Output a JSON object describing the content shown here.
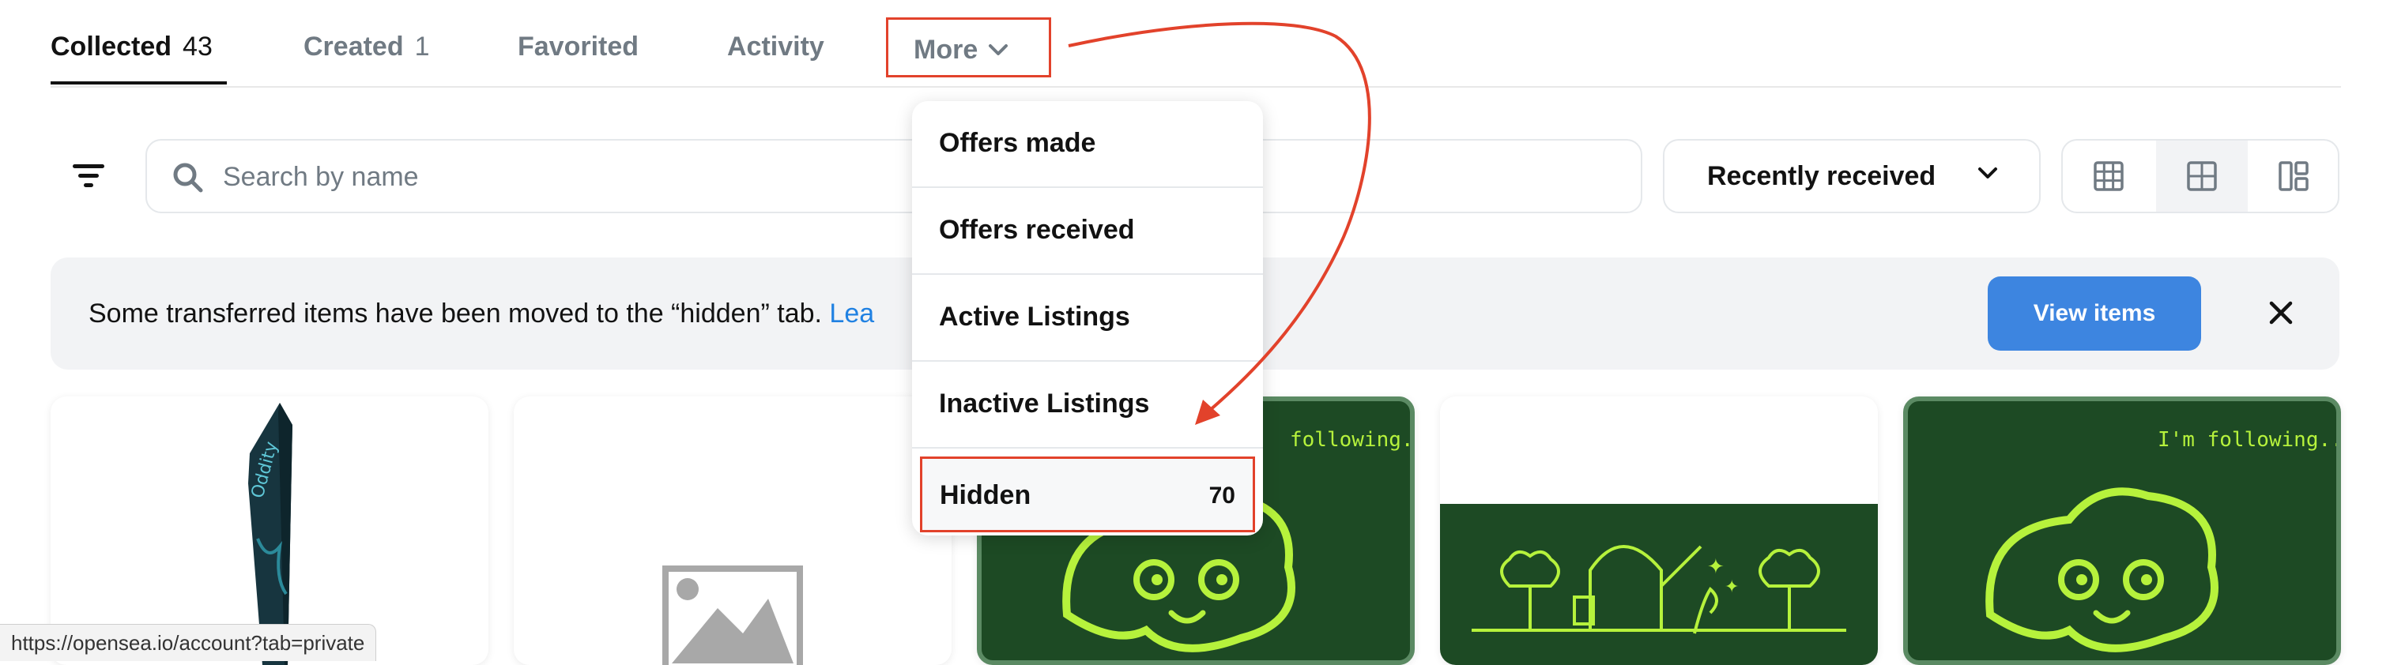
{
  "tabs": [
    {
      "label": "Collected",
      "count": "43"
    },
    {
      "label": "Created",
      "count": "1"
    },
    {
      "label": "Favorited"
    },
    {
      "label": "Activity"
    },
    {
      "label": "More"
    }
  ],
  "search": {
    "placeholder": "Search by name"
  },
  "sort": {
    "selected": "Recently received"
  },
  "view_modes": [
    "grid-large-icon",
    "grid-medium-icon",
    "layout-icon"
  ],
  "banner": {
    "message": "Some transferred items have been moved to the “hidden” tab. ",
    "link": "Lea",
    "button": "View items"
  },
  "dropdown": {
    "items": [
      {
        "label": "Offers made"
      },
      {
        "label": "Offers received"
      },
      {
        "label": "Active Listings"
      },
      {
        "label": "Inactive Listings"
      }
    ],
    "hidden": {
      "label": "Hidden",
      "count": "70"
    }
  },
  "cards": [
    {
      "caption": ""
    },
    {
      "caption": ""
    },
    {
      "caption": "following..."
    },
    {
      "caption": ""
    },
    {
      "caption": "I'm following..."
    }
  ],
  "status_url": "https://opensea.io/account?tab=private",
  "colors": {
    "annotation": "#e2422b",
    "accent": "#2081e2",
    "button": "#3d85e0",
    "card_green": "#1d4a24",
    "lime": "#b6f23c"
  }
}
